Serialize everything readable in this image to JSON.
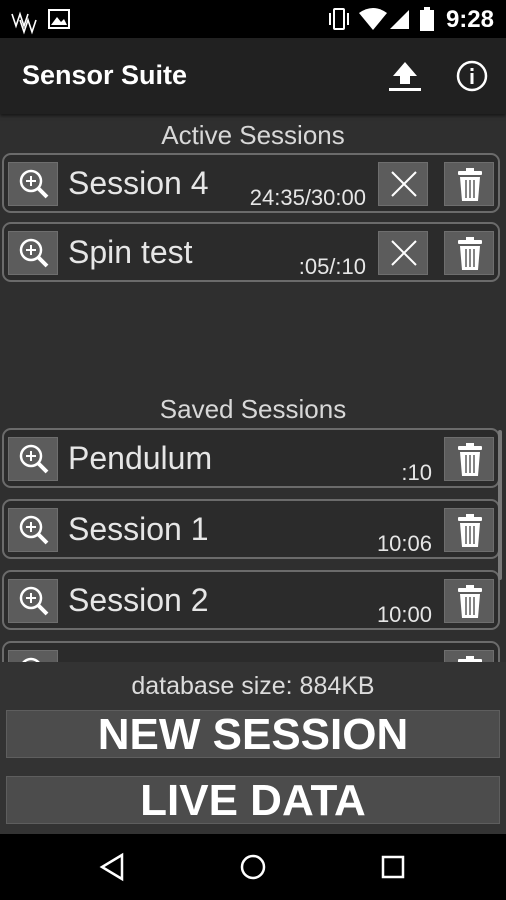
{
  "status_bar": {
    "time": "9:28"
  },
  "app_bar": {
    "title": "Sensor Suite"
  },
  "active_section": {
    "title": "Active Sessions",
    "sessions": [
      {
        "name": "Session 4",
        "duration": "24:35/30:00"
      },
      {
        "name": "Spin test",
        "duration": ":05/:10"
      }
    ]
  },
  "saved_section": {
    "title": "Saved Sessions",
    "sessions": [
      {
        "name": "Pendulum",
        "duration": ":10"
      },
      {
        "name": "Session 1",
        "duration": "10:06"
      },
      {
        "name": "Session 2",
        "duration": "10:00"
      },
      {
        "name": "",
        "duration": ""
      }
    ]
  },
  "footer": {
    "database_size": "database size: 884KB",
    "new_session_label": "NEW SESSION",
    "live_data_label": "LIVE DATA"
  },
  "icons": {
    "search": "magnifier-plus-icon",
    "cancel": "close-icon",
    "delete": "trash-icon",
    "upload": "upload-icon",
    "info": "info-icon"
  },
  "colors": {
    "background": "#2f2f2f",
    "app_bar": "#212121",
    "button": "#5c5c5c",
    "row_border": "#6b6b6b"
  }
}
